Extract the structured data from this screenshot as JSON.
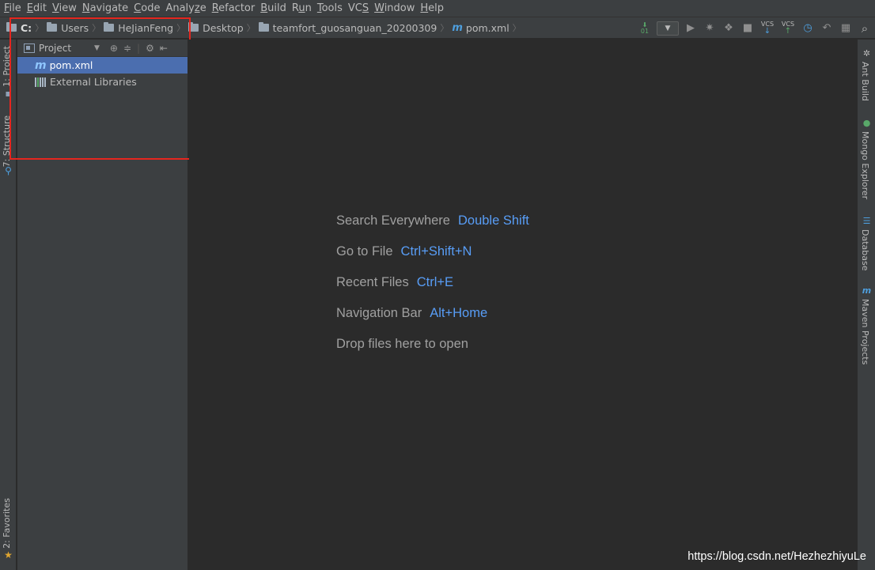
{
  "menu": [
    {
      "mnemonic": "F",
      "rest": "ile"
    },
    {
      "mnemonic": "E",
      "rest": "dit"
    },
    {
      "mnemonic": "V",
      "rest": "iew"
    },
    {
      "mnemonic": "N",
      "rest": "avigate"
    },
    {
      "mnemonic": "C",
      "rest": "ode"
    },
    {
      "pre": "Analy",
      "mnemonic": "z",
      "rest": "e"
    },
    {
      "mnemonic": "R",
      "rest": "efactor"
    },
    {
      "mnemonic": "B",
      "rest": "uild"
    },
    {
      "pre": "R",
      "mnemonic": "u",
      "rest": "n"
    },
    {
      "mnemonic": "T",
      "rest": "ools"
    },
    {
      "pre": "VC",
      "mnemonic": "S",
      "rest": ""
    },
    {
      "mnemonic": "W",
      "rest": "indow"
    },
    {
      "mnemonic": "H",
      "rest": "elp"
    }
  ],
  "breadcrumb": [
    "C:",
    "Users",
    "HeJianFeng",
    "Desktop",
    "teamfort_guosanguan_20200309",
    "pom.xml"
  ],
  "toolbar": {
    "vcs_update": "VCS",
    "vcs_commit": "VCS",
    "sort_label": "01"
  },
  "left_strip": {
    "project_tab": "1: Project",
    "structure_tab": "7: Structure",
    "favorites_tab": "2: Favorites"
  },
  "project_panel": {
    "title": "Project",
    "tree": [
      {
        "label": "pom.xml",
        "icon": "maven-icon",
        "selected": true
      },
      {
        "label": "External Libraries",
        "icon": "library-icon",
        "selected": false
      }
    ]
  },
  "editor_hints": [
    {
      "text": "Search Everywhere",
      "key": "Double Shift"
    },
    {
      "text": "Go to File",
      "key": "Ctrl+Shift+N"
    },
    {
      "text": "Recent Files",
      "key": "Ctrl+E"
    },
    {
      "text": "Navigation Bar",
      "key": "Alt+Home"
    },
    {
      "text": "Drop files here to open",
      "key": ""
    }
  ],
  "right_strip": {
    "ant_build": "Ant Build",
    "mongo_explorer": "Mongo Explorer",
    "database": "Database",
    "maven_projects": "Maven Projects"
  },
  "watermark": "https://blog.csdn.net/HezhezhiyuLe",
  "colors": {
    "selection": "#4b6eaf",
    "highlight_box": "#e5261f",
    "shortcut": "#589df6",
    "maven": "#4e9fde"
  }
}
